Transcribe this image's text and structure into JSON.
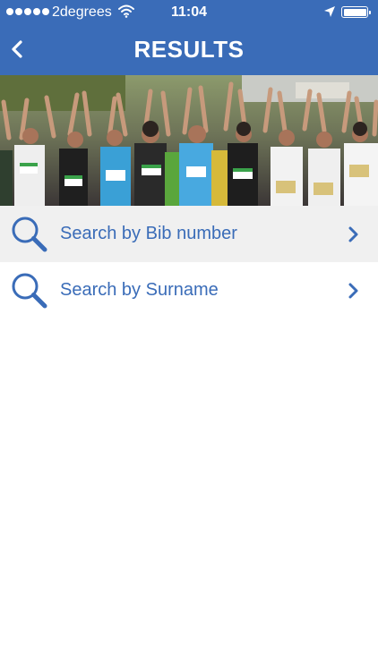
{
  "status_bar": {
    "carrier": "2degrees",
    "time": "11:04",
    "battery_level": 1.0
  },
  "header": {
    "title": "RESULTS",
    "back_icon": "chevron-left-icon",
    "background_color": "#3a6cb8"
  },
  "hero": {
    "image_description": "crowd of runners with raised arms"
  },
  "menu": {
    "items": [
      {
        "label": "Search by Bib number",
        "icon": "search-icon",
        "trailing_icon": "chevron-right-icon"
      },
      {
        "label": "Search by Surname",
        "icon": "search-icon",
        "trailing_icon": "chevron-right-icon"
      }
    ]
  },
  "colors": {
    "accent": "#3a6cb8",
    "row_highlight": "#f0f0f0"
  }
}
